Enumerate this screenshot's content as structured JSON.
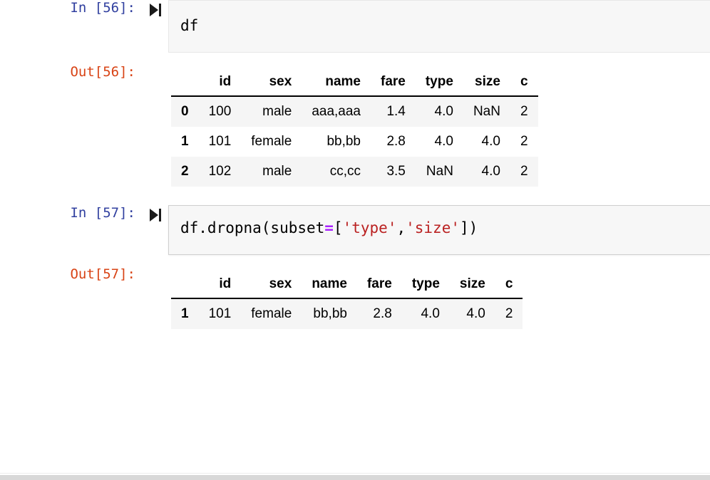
{
  "notebook": {
    "cells": [
      {
        "type": "code",
        "in_prompt": "In [56]:",
        "run_icon": "run-cell-icon",
        "source_plain": "df",
        "out_prompt": "Out[56]:",
        "table": {
          "index_header": "",
          "columns": [
            "id",
            "sex",
            "name",
            "fare",
            "type",
            "size",
            "c"
          ],
          "rows": [
            {
              "index": "0",
              "values": [
                "100",
                "male",
                "aaa,aaa",
                "1.4",
                "4.0",
                "NaN",
                "2"
              ]
            },
            {
              "index": "1",
              "values": [
                "101",
                "female",
                "bb,bb",
                "2.8",
                "4.0",
                "4.0",
                "2"
              ]
            },
            {
              "index": "2",
              "values": [
                "102",
                "male",
                "cc,cc",
                "3.5",
                "NaN",
                "4.0",
                "2"
              ]
            }
          ]
        }
      },
      {
        "type": "code",
        "in_prompt": "In [57]:",
        "run_icon": "run-cell-icon",
        "source_tokens": [
          {
            "text": "df.dropna(subset",
            "cls": "plain"
          },
          {
            "text": "=",
            "cls": "op"
          },
          {
            "text": "[",
            "cls": "plain"
          },
          {
            "text": "'type'",
            "cls": "str"
          },
          {
            "text": ",",
            "cls": "plain"
          },
          {
            "text": "'size'",
            "cls": "str"
          },
          {
            "text": "])",
            "cls": "plain"
          }
        ],
        "source_plain": "df.dropna(subset=['type','size'])",
        "out_prompt": "Out[57]:",
        "table": {
          "index_header": "",
          "columns": [
            "id",
            "sex",
            "name",
            "fare",
            "type",
            "size",
            "c"
          ],
          "rows": [
            {
              "index": "1",
              "values": [
                "101",
                "female",
                "bb,bb",
                "2.8",
                "4.0",
                "4.0",
                "2"
              ]
            }
          ]
        }
      }
    ]
  },
  "colors": {
    "in_prompt": "#303F9F",
    "out_prompt": "#D84315",
    "code_string": "#BA2121",
    "code_operator": "#AA22FF",
    "cell_background": "#f7f7f7",
    "row_stripe": "#f5f5f5"
  }
}
